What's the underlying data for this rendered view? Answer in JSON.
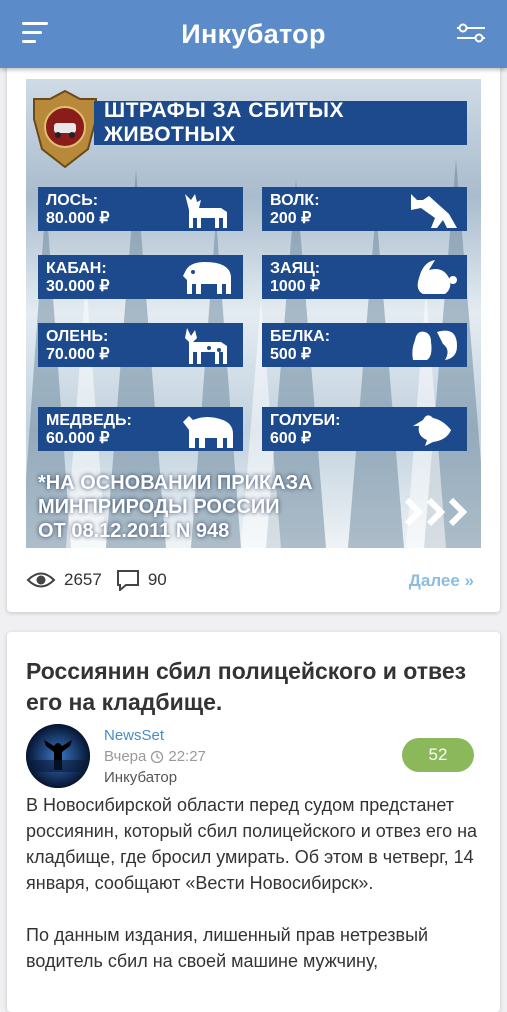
{
  "header": {
    "title": "Инкубатор",
    "menu_icon": "hamburger-menu-icon",
    "filter_icon": "filter-sliders-icon"
  },
  "post1": {
    "poster": {
      "title": "ШТРАФЫ ЗА СБИТЫХ ЖИВОТНЫХ",
      "fines": [
        {
          "name": "ЛОСЬ:",
          "amount": "80.000 ₽",
          "icon": "moose-icon"
        },
        {
          "name": "ВОЛК:",
          "amount": "200 ₽",
          "icon": "wolf-icon"
        },
        {
          "name": "КАБАН:",
          "amount": "30.000 ₽",
          "icon": "boar-icon"
        },
        {
          "name": "ЗАЯЦ:",
          "amount": "1000 ₽",
          "icon": "hare-icon"
        },
        {
          "name": "ОЛЕНЬ:",
          "amount": "70.000 ₽",
          "icon": "deer-icon"
        },
        {
          "name": "БЕЛКА:",
          "amount": "500 ₽",
          "icon": "squirrel-icon"
        },
        {
          "name": "МЕДВЕДЬ:",
          "amount": "60.000 ₽",
          "icon": "bear-icon"
        },
        {
          "name": "ГОЛУБИ:",
          "amount": "600 ₽",
          "icon": "pigeon-icon"
        }
      ],
      "note_lines": [
        "*НА ОСНОВАНИИ ПРИКАЗА",
        "МИНПРИРОДЫ РОССИИ",
        "ОТ 08.12.2011 N 948"
      ]
    },
    "views": "2657",
    "comments": "90",
    "more_label": "Далее »"
  },
  "post2": {
    "headline": "Россиянин сбил полицейского и отвез его на кладбище.",
    "source": "NewsSet",
    "time_day": "Вчера",
    "time_clock": "22:27",
    "category": "Инкубатор",
    "rating": "52",
    "paragraphs": [
      "В Новосибирской области перед судом предстанет россиянин, который сбил полицейского и отвез его на кладбище, где бросил умирать. Об этом в четверг, 14 января, сообщают «Вести Новосибирск».",
      "По данным издания, лишенный прав нетрезвый водитель сбил на своей машине мужчину,"
    ]
  },
  "colors": {
    "header_bg": "#5b8bc9",
    "poster_blue": "#1d4a8c",
    "rating_green": "#8ab85a",
    "link_blue": "#4a8bc4",
    "more_light_blue": "#8bbde0"
  }
}
